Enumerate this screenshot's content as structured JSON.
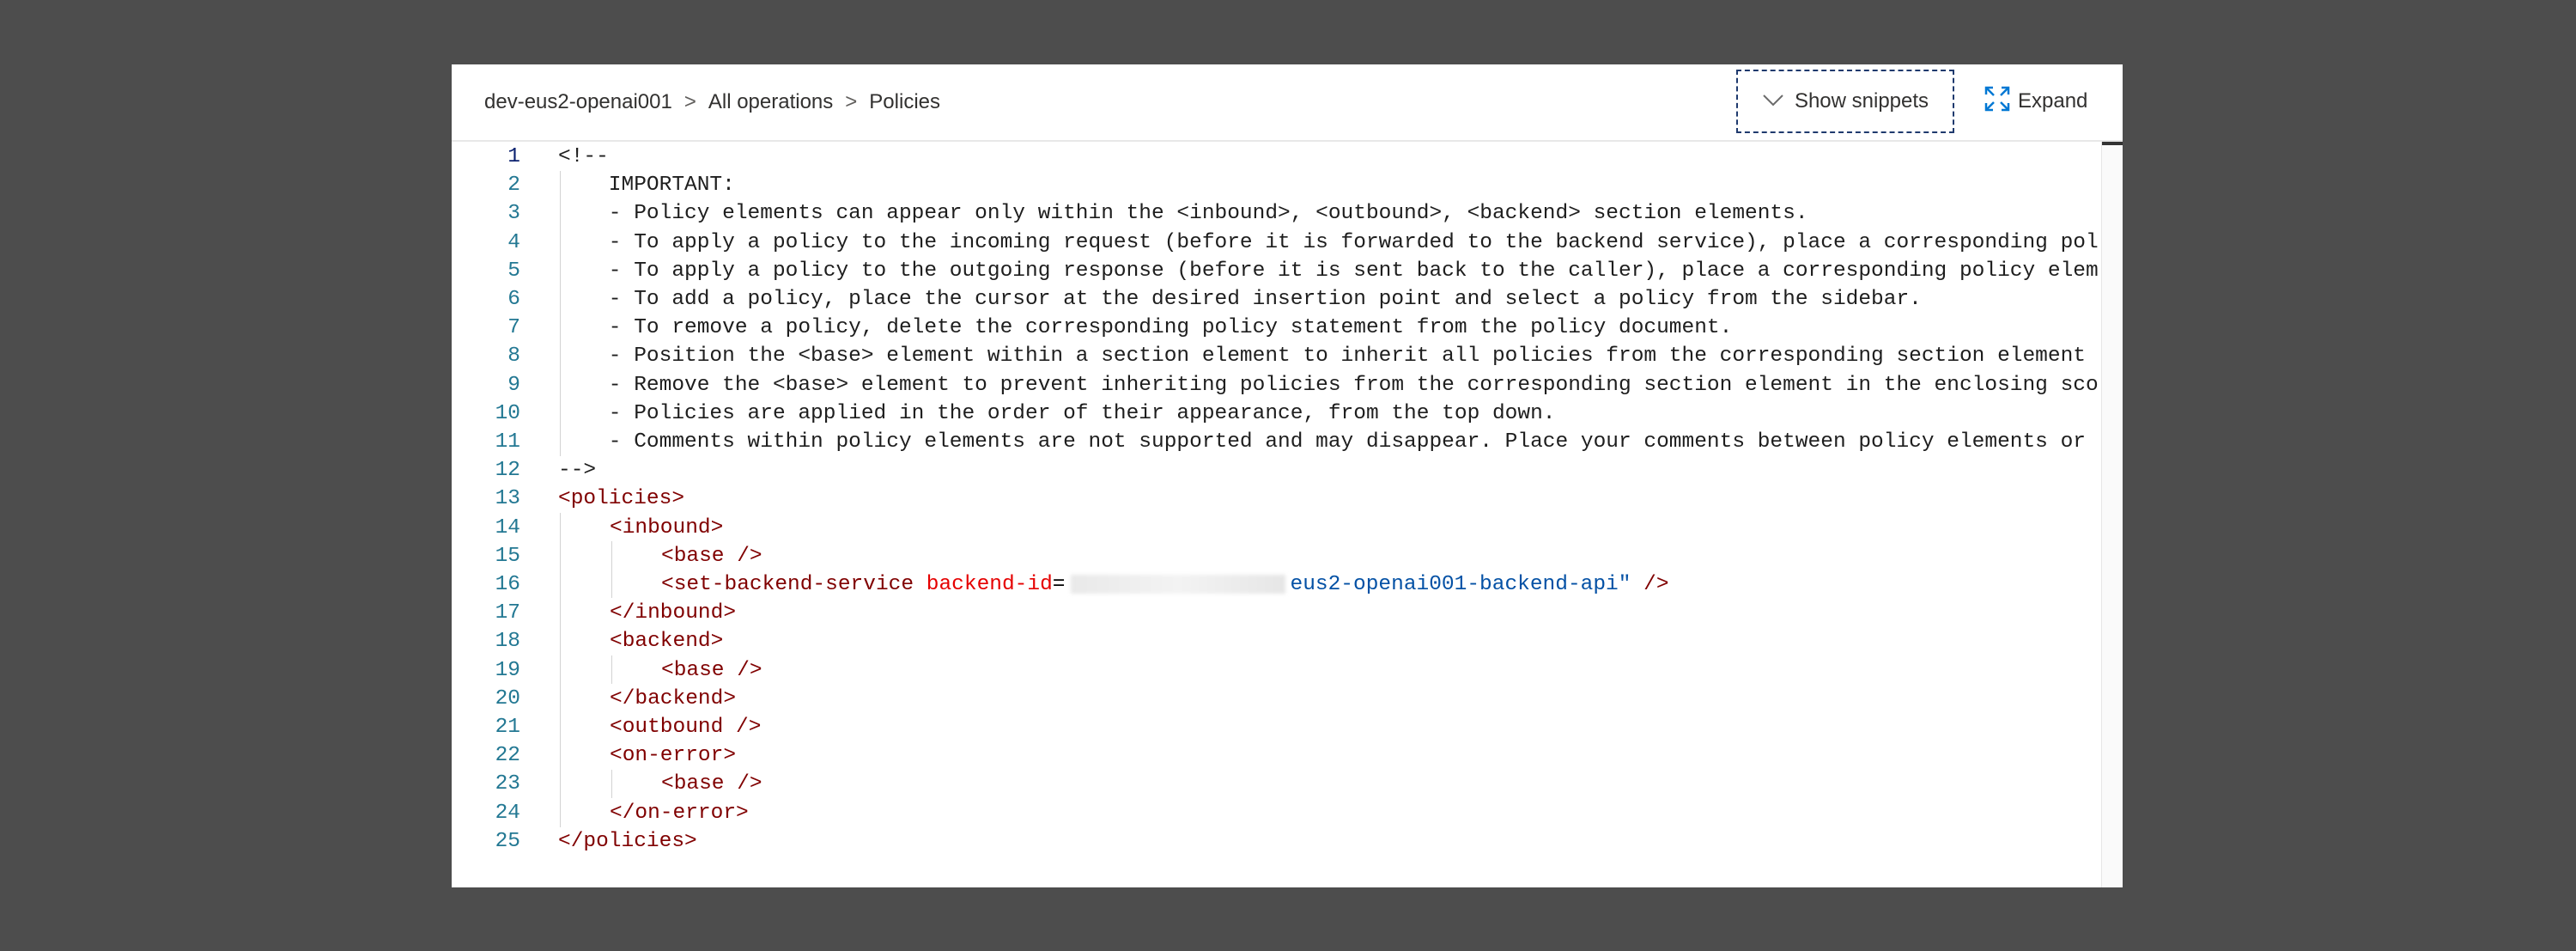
{
  "breadcrumb": {
    "items": [
      "dev-eus2-openai001",
      "All operations",
      "Policies"
    ],
    "separator": ">"
  },
  "toolbar": {
    "show_snippets_label": "Show snippets",
    "expand_label": "Expand"
  },
  "editor": {
    "line_numbers": [
      "1",
      "2",
      "3",
      "4",
      "5",
      "6",
      "7",
      "8",
      "9",
      "10",
      "11",
      "12",
      "13",
      "14",
      "15",
      "16",
      "17",
      "18",
      "19",
      "20",
      "21",
      "22",
      "23",
      "24",
      "25"
    ],
    "comment_lines": [
      "<!--",
      "    IMPORTANT:",
      "    - Policy elements can appear only within the <inbound>, <outbound>, <backend> section elements.",
      "    - To apply a policy to the incoming request (before it is forwarded to the backend service), place a corresponding pol",
      "    - To apply a policy to the outgoing response (before it is sent back to the caller), place a corresponding policy elem",
      "    - To add a policy, place the cursor at the desired insertion point and select a policy from the sidebar.",
      "    - To remove a policy, delete the corresponding policy statement from the policy document.",
      "    - Position the <base> element within a section element to inherit all policies from the corresponding section element",
      "    - Remove the <base> element to prevent inheriting policies from the corresponding section element in the enclosing sco",
      "    - Policies are applied in the order of their appearance, from the top down.",
      "    - Comments within policy elements are not supported and may disappear. Place your comments between policy elements or",
      "-->"
    ],
    "xml": {
      "policies_open": "<policies>",
      "inbound_open": "<inbound>",
      "base": "<base />",
      "set_backend_tag": "<set-backend-service",
      "set_backend_attr": "backend-id",
      "set_backend_eq": "=",
      "set_backend_value_visible": "eus2-openai001-backend-api\"",
      "set_backend_close": " />",
      "inbound_close": "</inbound>",
      "backend_open": "<backend>",
      "backend_close": "</backend>",
      "outbound_self": "<outbound />",
      "onerror_open": "<on-error>",
      "onerror_close": "</on-error>",
      "policies_close": "</policies>"
    }
  }
}
